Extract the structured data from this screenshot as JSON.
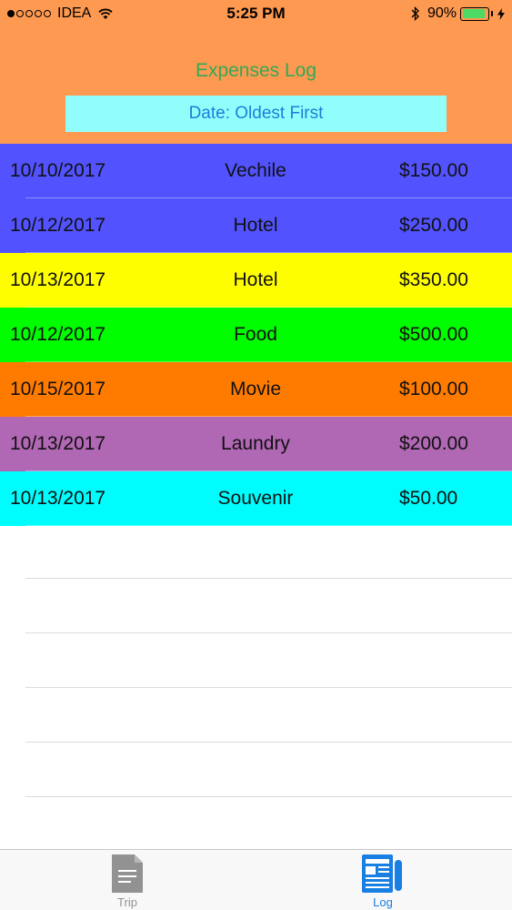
{
  "status_bar": {
    "carrier": "IDEA",
    "time": "5:25 PM",
    "battery_percent": "90%",
    "battery_level": 0.9,
    "signal_bars": 1
  },
  "header": {
    "title": "Expenses Log",
    "sort_button_label": "Date: Oldest First"
  },
  "expenses": [
    {
      "date": "10/10/2017",
      "category": "Vechile",
      "amount": "$150.00",
      "color": "#5252fe"
    },
    {
      "date": "10/12/2017",
      "category": "Hotel",
      "amount": "$250.00",
      "color": "#5252fe"
    },
    {
      "date": "10/13/2017",
      "category": "Hotel",
      "amount": "$350.00",
      "color": "#fffe00"
    },
    {
      "date": "10/12/2017",
      "category": "Food",
      "amount": "$500.00",
      "color": "#00fd00"
    },
    {
      "date": "10/15/2017",
      "category": "Movie",
      "amount": "$100.00",
      "color": "#ff7b00"
    },
    {
      "date": "10/13/2017",
      "category": "Laundry",
      "amount": "$200.00",
      "color": "#b067b4"
    },
    {
      "date": "10/13/2017",
      "category": "Souvenir",
      "amount": "$50.00",
      "color": "#00fdfe"
    }
  ],
  "tabs": [
    {
      "label": "Trip",
      "icon": "document-icon",
      "active": false
    },
    {
      "label": "Log",
      "icon": "newspaper-icon",
      "active": true
    }
  ],
  "colors": {
    "header_bg": "#fe9951",
    "title": "#33a857",
    "sort_button_bg": "#91fefc",
    "sort_button_text": "#1b7ed9",
    "tab_active": "#1a7fe3",
    "tab_inactive": "#929292"
  }
}
